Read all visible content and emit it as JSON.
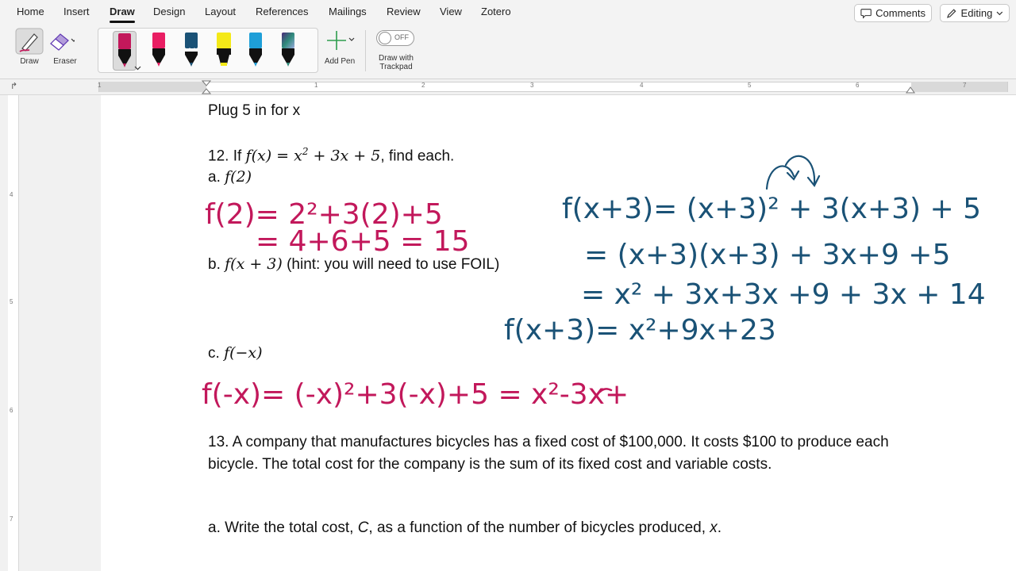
{
  "menu": {
    "tabs": [
      "Home",
      "Insert",
      "Draw",
      "Design",
      "Layout",
      "References",
      "Mailings",
      "Review",
      "View",
      "Zotero"
    ],
    "active_tab": "Draw",
    "comments_label": "Comments",
    "editing_label": "Editing"
  },
  "ribbon": {
    "draw_label": "Draw",
    "eraser_label": "Eraser",
    "add_pen_label": "Add Pen",
    "toggle_state": "OFF",
    "trackpad_label_1": "Draw with",
    "trackpad_label_2": "Trackpad",
    "pens": [
      {
        "color": "#c2185b",
        "selected": true
      },
      {
        "color": "#e91e63",
        "selected": false
      },
      {
        "color": "#1a5276",
        "selected": false
      },
      {
        "color": "#f4e918",
        "selected": false
      },
      {
        "color": "#1e9fd8",
        "selected": false
      },
      {
        "color": "#2e8b7a",
        "selected": false
      }
    ]
  },
  "ruler": {
    "h_numbers": [
      "1",
      "1",
      "2",
      "3",
      "4",
      "5",
      "6",
      "7"
    ],
    "v_numbers": [
      "4",
      "5",
      "6",
      "7"
    ]
  },
  "document": {
    "line_plug": "Plug 5 in for x",
    "q12_prefix": "12.  If ",
    "q12_fx": "f(x) = x",
    "q12_sup": "2",
    "q12_rest": " + 3x + 5",
    "q12_suffix": ", find each.",
    "q12_a_label": "a.  ",
    "q12_a_math": "f(2)",
    "q12_b_label": "b.  ",
    "q12_b_math": "f(x + 3)",
    "q12_b_hint": " (hint: you will need to use FOIL)",
    "q12_c_label": "c.  ",
    "q12_c_math": "f(−x)",
    "q13_text": "13.  A company that manufactures bicycles has a fixed cost of $100,000. It costs $100 to produce each bicycle. The total cost for the company is the sum of its fixed cost and variable costs.",
    "q13_a_prefix": "a.  Write the total cost, ",
    "q13_a_c": "C",
    "q13_a_mid": ", as a function of the number of bicycles produced, ",
    "q13_a_x": "x",
    "q13_a_end": "."
  },
  "ink": {
    "colors": {
      "magenta": "#c2185b",
      "blue": "#1a5276"
    },
    "a_line1": "f(2)= 2²+3(2)+5",
    "a_line2": "= 4+6+5 = 15",
    "b_line1": "f(x+3)=  (x+3)² + 3(x+3) + 5",
    "b_line2": "= (x+3)(x+3) + 3x+9 +5",
    "b_line3": "= x² + 3x+3x +9 + 3x + 14",
    "b_line4": "f(x+3)= x²+9x+23",
    "c_line1": "f(-x)= (-x)²+3(-x)+5 = x²-3x+"
  }
}
